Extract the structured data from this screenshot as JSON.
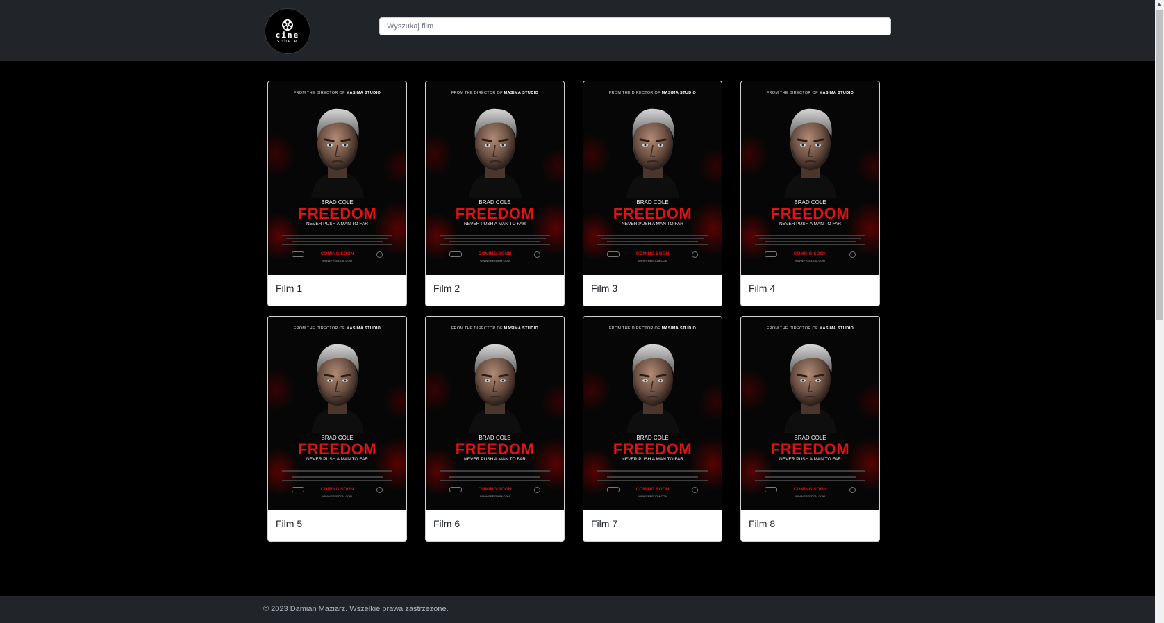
{
  "brand": {
    "logo_text": "cine",
    "logo_subtext": "sphere"
  },
  "search": {
    "placeholder": "Wyszukaj film",
    "value": ""
  },
  "poster": {
    "top_line_prefix": "FROM THE DIRECTOR OF",
    "top_line_studio": "MASIMA STUDIO",
    "actor": "BRAD COLE",
    "title": "FREEDOM",
    "tagline": "NEVER PUSH A MAN TO FAR",
    "release": "COMING SOON",
    "url": "WWW.FREEDOM.COM"
  },
  "movies": [
    {
      "title": "Film 1"
    },
    {
      "title": "Film 2"
    },
    {
      "title": "Film 3"
    },
    {
      "title": "Film 4"
    },
    {
      "title": "Film 5"
    },
    {
      "title": "Film 6"
    },
    {
      "title": "Film 7"
    },
    {
      "title": "Film 8"
    }
  ],
  "footer": {
    "copyright": "© 2023 Damian Maziarz. Wszelkie prawa zastrzeżone."
  },
  "colors": {
    "header_bg": "#212529",
    "page_bg": "#000000",
    "poster_title": "#e11212"
  }
}
